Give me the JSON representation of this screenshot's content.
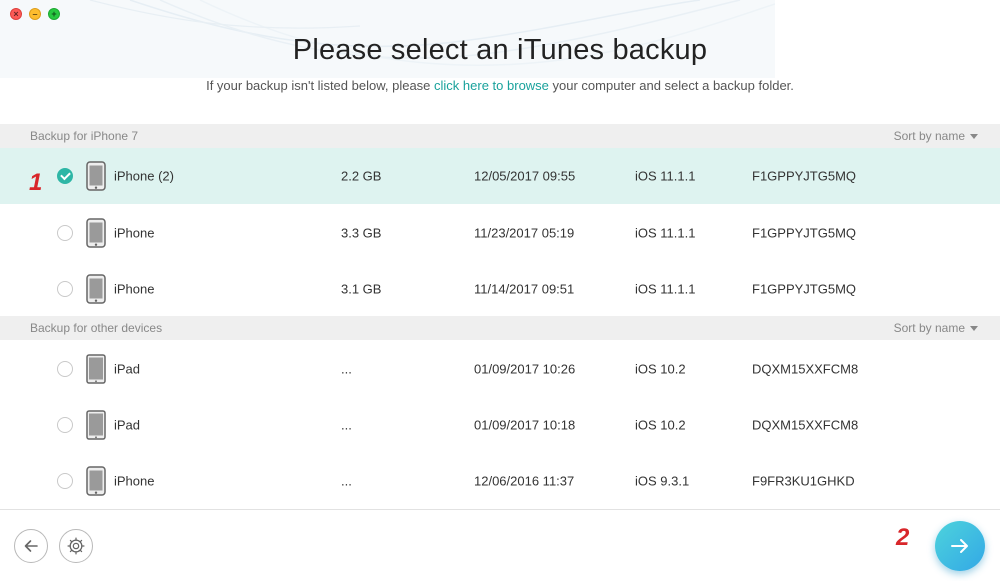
{
  "window": {
    "controls": {
      "close": "×",
      "minimize": "–",
      "maximize": "+"
    }
  },
  "header": {
    "title": "Please select an iTunes backup",
    "subtitle_before": "If your backup isn't listed below, please ",
    "subtitle_link": "click here to browse",
    "subtitle_after": " your computer and select a backup folder."
  },
  "sections": [
    {
      "label": "Backup for iPhone 7",
      "sort_label": "Sort by name",
      "rows": [
        {
          "name": "iPhone (2)",
          "size": "2.2 GB",
          "date": "12/05/2017 09:55",
          "ios": "iOS 11.1.1",
          "serial": "F1GPPYJTG5MQ",
          "selected": true,
          "device": "iphone"
        },
        {
          "name": "iPhone",
          "size": "3.3 GB",
          "date": "11/23/2017 05:19",
          "ios": "iOS 11.1.1",
          "serial": "F1GPPYJTG5MQ",
          "selected": false,
          "device": "iphone"
        },
        {
          "name": "iPhone",
          "size": "3.1 GB",
          "date": "11/14/2017 09:51",
          "ios": "iOS 11.1.1",
          "serial": "F1GPPYJTG5MQ",
          "selected": false,
          "device": "iphone"
        }
      ]
    },
    {
      "label": "Backup for other devices",
      "sort_label": "Sort by name",
      "rows": [
        {
          "name": "iPad",
          "size": "...",
          "date": "01/09/2017 10:26",
          "ios": "iOS 10.2",
          "serial": "DQXM15XXFCM8",
          "selected": false,
          "device": "ipad"
        },
        {
          "name": "iPad",
          "size": "...",
          "date": "01/09/2017 10:18",
          "ios": "iOS 10.2",
          "serial": "DQXM15XXFCM8",
          "selected": false,
          "device": "ipad"
        },
        {
          "name": "iPhone",
          "size": "...",
          "date": "12/06/2016 11:37",
          "ios": "iOS 9.3.1",
          "serial": "F9FR3KU1GHKD",
          "selected": false,
          "device": "iphone"
        }
      ]
    }
  ],
  "annotations": {
    "step1": "1",
    "step2": "2"
  },
  "footer": {
    "back_icon": "arrow-left-icon",
    "settings_icon": "gear-icon",
    "next_icon": "arrow-right-icon"
  },
  "colors": {
    "accent": "#2eb6a6",
    "link": "#1aa29c",
    "selected_row": "#def3f0",
    "section_header": "#efefef",
    "annotation": "#d8262a"
  }
}
